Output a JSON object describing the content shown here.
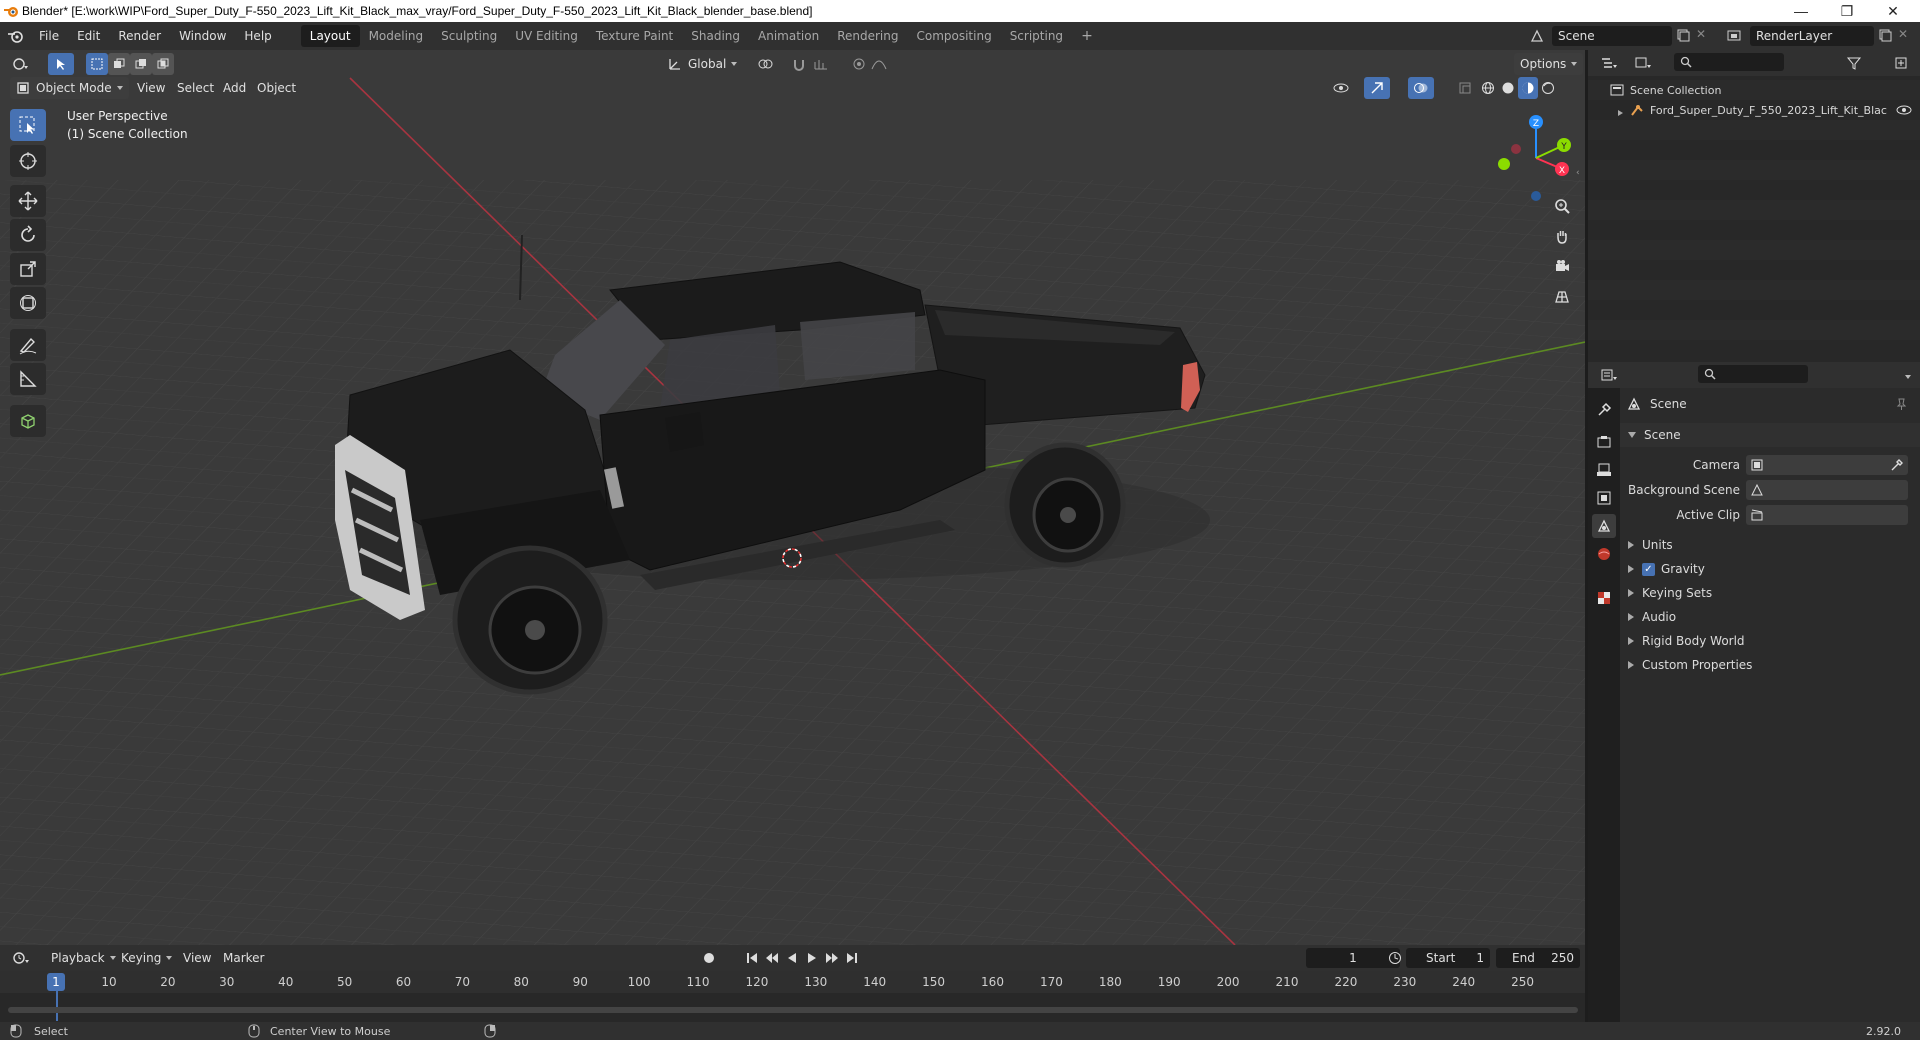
{
  "window": {
    "title": "Blender* [E:\\work\\WIP\\Ford_Super_Duty_F-550_2023_Lift_Kit_Black_max_vray/Ford_Super_Duty_F-550_2023_Lift_Kit_Black_blender_base.blend]",
    "minimize": "—",
    "maximize": "❐",
    "close": "✕"
  },
  "menu": [
    "File",
    "Edit",
    "Render",
    "Window",
    "Help"
  ],
  "workspaces": [
    "Layout",
    "Modeling",
    "Sculpting",
    "UV Editing",
    "Texture Paint",
    "Shading",
    "Animation",
    "Rendering",
    "Compositing",
    "Scripting"
  ],
  "active_workspace": "Layout",
  "add_workspace": "+",
  "scene_selector": {
    "value": "Scene"
  },
  "render_layer": {
    "value": "RenderLayer"
  },
  "viewport": {
    "transform_orientation": "Global",
    "options": "Options",
    "mode": "Object Mode",
    "header_menus": [
      "View",
      "Select",
      "Add",
      "Object"
    ],
    "overlay_text_1": "User Perspective",
    "overlay_text_2": "(1) Scene Collection",
    "gizmo_axes": {
      "x": "X",
      "y": "Y",
      "z": "Z"
    },
    "colors": {
      "x_axis": "#ff3352",
      "y_axis": "#8bdc00",
      "z_axis": "#2890ff",
      "grid_bg": "#3a3a3a"
    }
  },
  "outliner": {
    "root": "Scene Collection",
    "items": [
      {
        "label": "Ford_Super_Duty_F_550_2023_Lift_Kit_Blac"
      }
    ]
  },
  "properties": {
    "context": "Scene",
    "section": "Scene",
    "fields": [
      {
        "label": "Camera"
      },
      {
        "label": "Background Scene"
      },
      {
        "label": "Active Clip"
      }
    ],
    "panels": [
      "Units",
      "Gravity",
      "Keying Sets",
      "Audio",
      "Rigid Body World",
      "Custom Properties"
    ],
    "gravity_checked": true
  },
  "timeline": {
    "menus": [
      "Playback",
      "Keying",
      "View",
      "Marker"
    ],
    "current_frame": "1",
    "start_label": "Start",
    "start": "1",
    "end_label": "End",
    "end": "250",
    "ruler": [
      "1",
      "10",
      "20",
      "30",
      "40",
      "50",
      "60",
      "70",
      "80",
      "90",
      "100",
      "110",
      "120",
      "130",
      "140",
      "150",
      "160",
      "170",
      "180",
      "190",
      "200",
      "210",
      "220",
      "230",
      "240",
      "250"
    ]
  },
  "status": {
    "left": "Select",
    "middle": "Center View to Mouse",
    "version": "2.92.0"
  }
}
